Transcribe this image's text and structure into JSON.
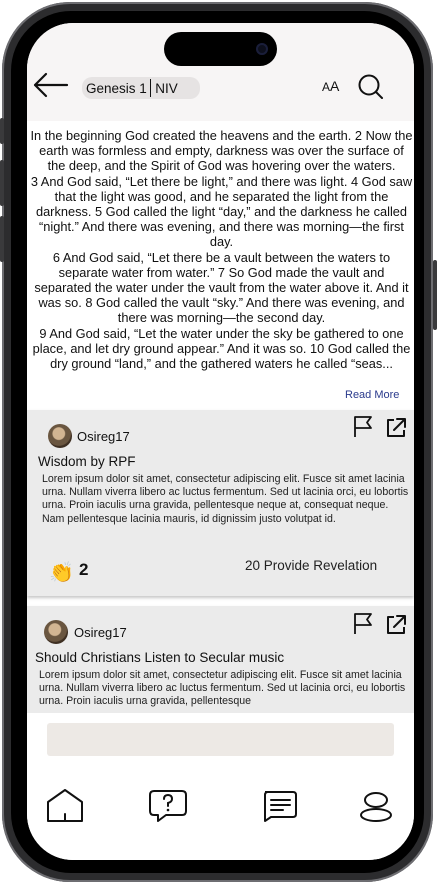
{
  "header": {
    "back_icon": "arrow-left-icon",
    "book_reference": "Genesis 1",
    "translation": "NIV",
    "font_size_label_small": "A",
    "font_size_label_large": "A",
    "search_icon": "search-icon"
  },
  "scripture": {
    "text": "In the beginning God created the heavens and the earth. 2 Now the earth was formless and empty, darkness was over the surface of the deep, and the Spirit of God was hovering over the waters.\n3 And God said, “Let there be light,” and there was light. 4 God saw that the light was good, and he separated the light from the darkness. 5 God called the light “day,” and the darkness he called “night.” And there was evening, and there was morning—the first day.\n6 And God said, “Let there be a vault between the waters to separate water from water.” 7 So God made the vault and separated the water under the vault from the water above it. And it was so. 8 God called the vault “sky.” And there was evening, and there was morning—the second day.\n9 And God said, “Let the water under the sky be gathered to one place, and let dry ground appear.” And it was so. 10 God called the dry ground “land,” and the gathered waters he called “seas...",
    "read_more_label": "Read More"
  },
  "posts": [
    {
      "username": "Osireg17",
      "title": "Wisdom by RPF",
      "body": "Lorem ipsum dolor sit amet, consectetur adipiscing elit. Fusce sit amet lacinia urna. Nullam viverra libero ac luctus fermentum. Sed ut lacinia orci, eu lobortis urna. Proin iaculis urna gravida, pellentesque neque at, consequat neque. Nam pellentesque lacinia mauris, id dignissim justo volutpat id.",
      "clap_icon": "clapping-hands-icon",
      "clap_emoji": "👏",
      "clap_count": "2",
      "revelation_label": "20 Provide Revelation",
      "flag_icon": "flag-icon",
      "share_icon": "external-link-icon"
    },
    {
      "username": "Osireg17",
      "title": "Should Christians Listen to Secular music",
      "body": "Lorem ipsum dolor sit amet, consectetur adipiscing elit. Fusce sit amet lacinia urna. Nullam viverra libero ac luctus fermentum. Sed ut lacinia orci, eu lobortis urna. Proin iaculis urna gravida, pellentesque",
      "flag_icon": "flag-icon",
      "share_icon": "external-link-icon"
    }
  ],
  "bottom_nav": {
    "items": [
      {
        "icon": "home-icon"
      },
      {
        "icon": "question-chat-icon"
      },
      {
        "icon": "message-icon"
      },
      {
        "icon": "profile-icon"
      }
    ]
  },
  "colors": {
    "topbar_bg": "#f7f5f5",
    "card_bg": "#ebebeb",
    "compose_bg": "#ede9e5",
    "link": "#2a3a8c"
  }
}
